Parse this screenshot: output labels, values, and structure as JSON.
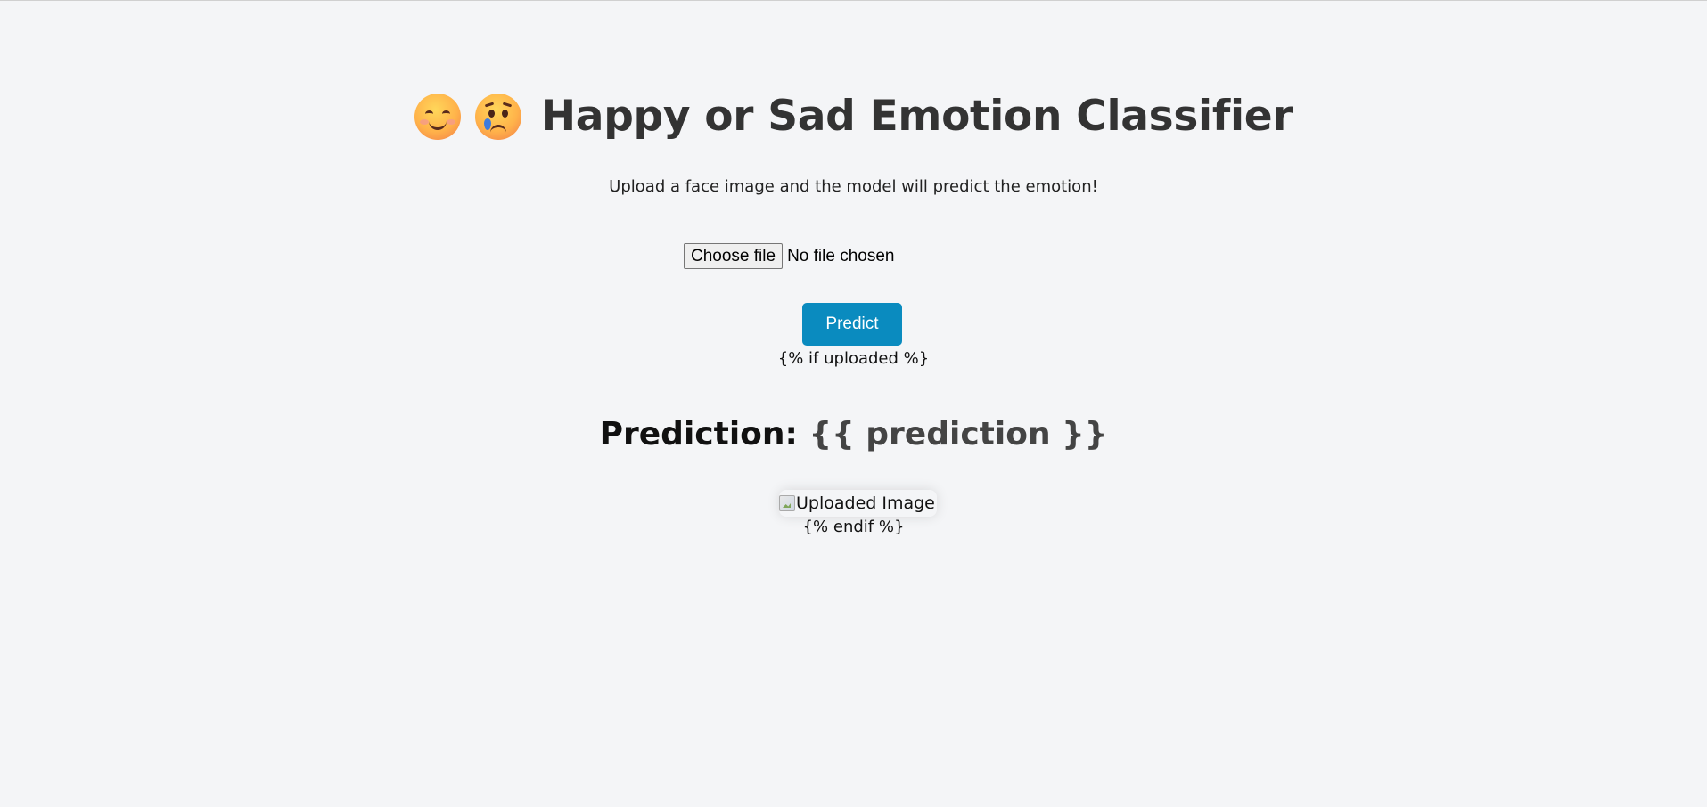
{
  "header": {
    "title": "Happy or Sad Emotion Classifier",
    "emojis": [
      "happy-face-icon",
      "sad-face-icon"
    ]
  },
  "subtitle": "Upload a face image and the model will predict the emotion!",
  "upload": {
    "button_label": "Choose file",
    "status": "No file chosen"
  },
  "predict_button": "Predict",
  "template": {
    "if_tag": "{% if uploaded %}",
    "endif_tag": "{% endif %}"
  },
  "result": {
    "label": "Prediction:",
    "value": "{{ prediction }}"
  },
  "uploaded_image": {
    "alt": "Uploaded Image"
  },
  "colors": {
    "background": "#f4f5f7",
    "title": "#333333",
    "predict_button": "#0a8bbf"
  }
}
